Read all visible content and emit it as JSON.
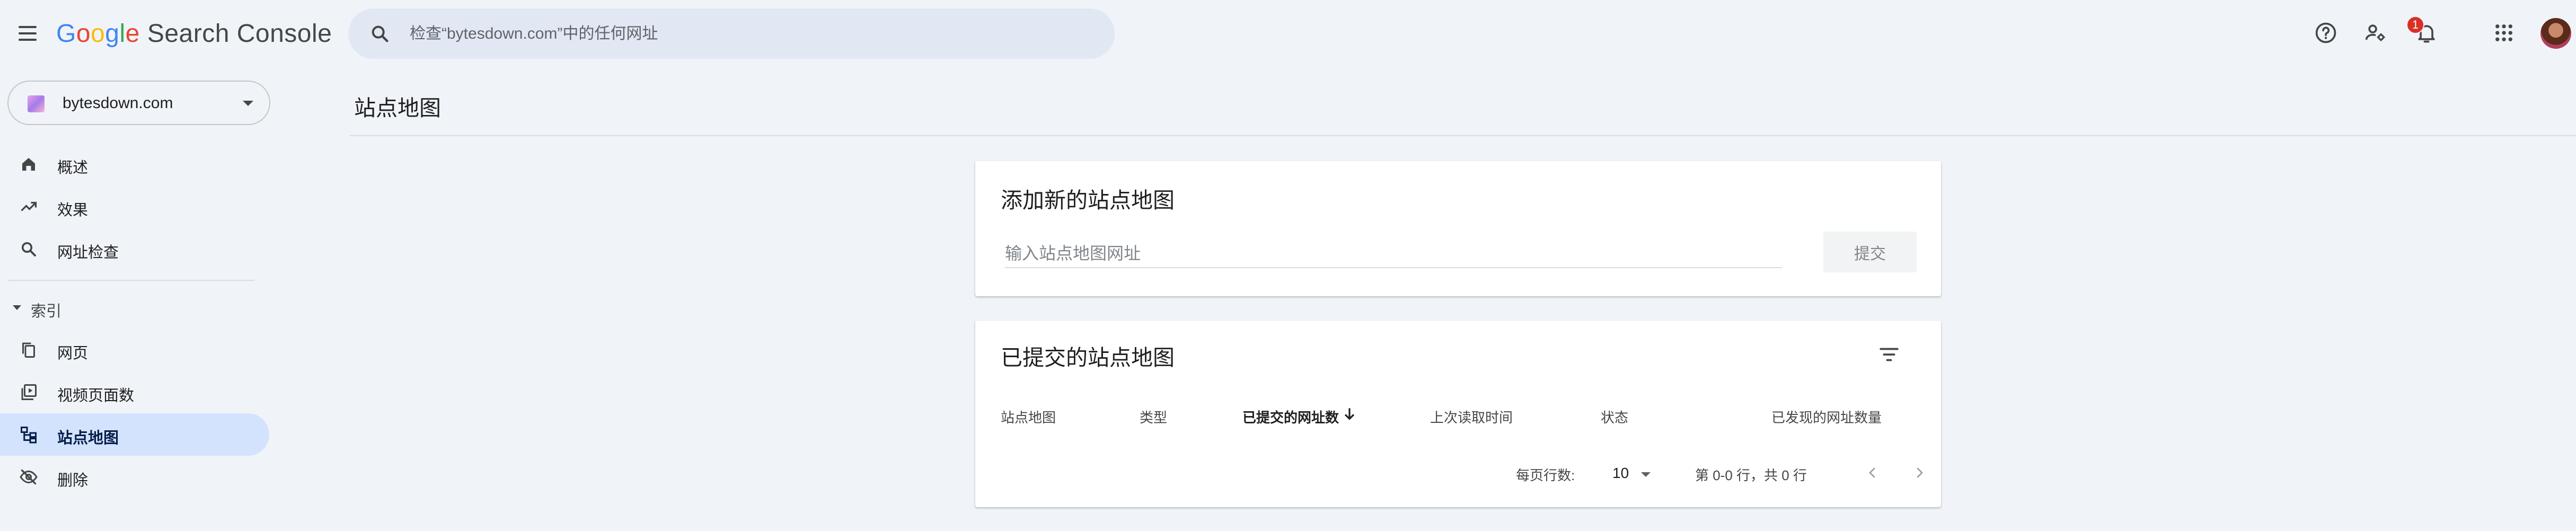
{
  "header": {
    "logo_letters": [
      "G",
      "o",
      "o",
      "g",
      "l",
      "e"
    ],
    "product_name": "Search Console",
    "search_placeholder": "检查“bytesdown.com”中的任何网址",
    "notification_count": "1",
    "icons": [
      "menu-icon",
      "search-icon",
      "help-icon",
      "manage-users-icon",
      "notifications-icon",
      "apps-icon",
      "avatar"
    ]
  },
  "sidebar": {
    "property": "bytesdown.com",
    "items": [
      {
        "label": "概述",
        "icon": "home-icon"
      },
      {
        "label": "效果",
        "icon": "trending-up-icon"
      },
      {
        "label": "网址检查",
        "icon": "search-icon"
      }
    ],
    "index_section": {
      "label": "索引",
      "items": [
        {
          "label": "网页",
          "icon": "file-copy-icon"
        },
        {
          "label": "视频页面数",
          "icon": "video-library-icon"
        },
        {
          "label": "站点地图",
          "icon": "sitemap-icon",
          "active": true
        },
        {
          "label": "删除",
          "icon": "visibility-off-icon"
        }
      ]
    }
  },
  "main": {
    "page_title": "站点地图",
    "add_card": {
      "title": "添加新的站点地图",
      "input_placeholder": "输入站点地图网址",
      "submit_label": "提交"
    },
    "submitted_card": {
      "title": "已提交的站点地图",
      "columns": [
        "站点地图",
        "类型",
        "已提交的网址数",
        "上次读取时间",
        "状态",
        "已发现的网址数量"
      ],
      "sorted_column": "已提交的网址数",
      "rows_per_page_label": "每页行数:",
      "rows_per_page_value": "10",
      "pagination_text": "第 0-0 行，共 0 行"
    }
  }
}
